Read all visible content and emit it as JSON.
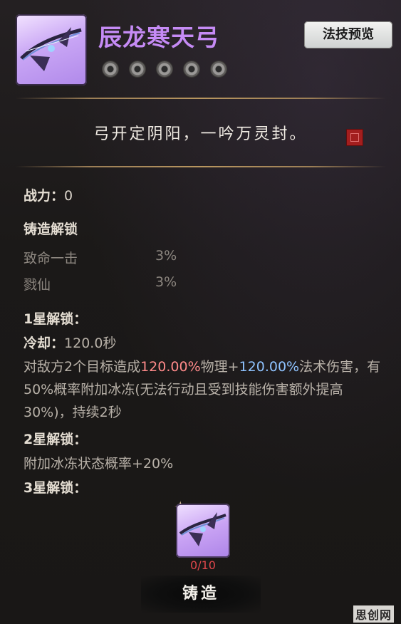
{
  "item": {
    "name": "辰龙寒天弓",
    "icon": "ice-dragon-bow",
    "preview_button": "法技预览",
    "star_count": 5,
    "quote": "弓开定阴阳，一吟万灵封。"
  },
  "power": {
    "label": "战力：",
    "value": "0"
  },
  "forge_unlock": {
    "title": "铸造解锁",
    "stats": [
      {
        "name": "致命一击",
        "value": "3%"
      },
      {
        "name": "戮仙",
        "value": "3%"
      }
    ]
  },
  "star1": {
    "title": "1星解锁：",
    "cooldown_label": "冷却：",
    "cooldown_value": "120.0秒",
    "desc_part1": "对敌方2个目标造成",
    "desc_phys": "120.00%",
    "desc_part2": "物理+",
    "desc_magic": "120.00%",
    "desc_part3": "法术伤害，有50%概率附加冰冻(无法行动且受到技能伤害额外提高30%)，持续2秒"
  },
  "star2": {
    "title": "2星解锁：",
    "desc": "附加冰冻状态概率+20%"
  },
  "star3": {
    "title": "3星解锁："
  },
  "material": {
    "count": "0/10",
    "icon": "bow-fragment"
  },
  "forge_button": "铸造",
  "watermark": "思创网",
  "colors": {
    "name": "#c58bf5",
    "physical": "#ff8a8a",
    "magic": "#8fc3ff",
    "count": "#e0474b"
  }
}
